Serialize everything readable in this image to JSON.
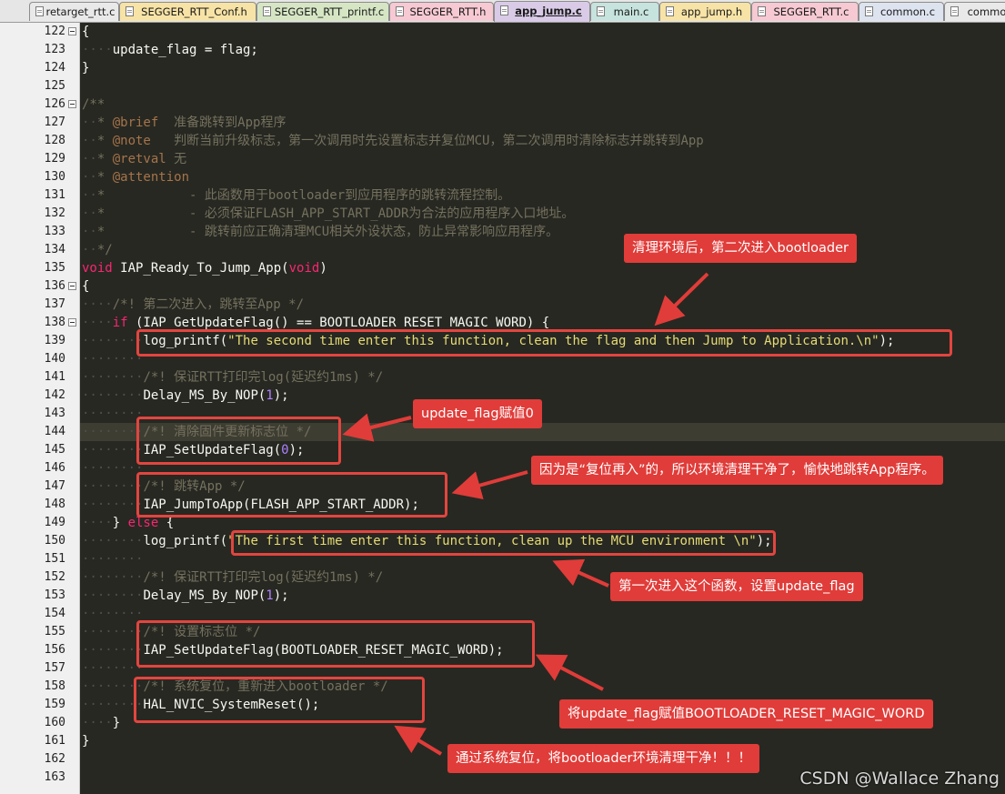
{
  "tabs": [
    {
      "label": "retarget_rtt.c",
      "color": "#e9e9e9",
      "active": false
    },
    {
      "label": "SEGGER_RTT_Conf.h",
      "color": "#f7e3a6",
      "active": false
    },
    {
      "label": "SEGGER_RTT_printf.c",
      "color": "#d6e6c4",
      "active": false
    },
    {
      "label": "SEGGER_RTT.h",
      "color": "#f6c9d3",
      "active": false
    },
    {
      "label": "app_jump.c",
      "color": "#d9cbe7",
      "active": true
    },
    {
      "label": "main.c",
      "color": "#c6e3dd",
      "active": false
    },
    {
      "label": "app_jump.h",
      "color": "#f7e3a6",
      "active": false
    },
    {
      "label": "SEGGER_RTT.c",
      "color": "#f6c9d3",
      "active": false
    },
    {
      "label": "common.c",
      "color": "#dde3ef",
      "active": false
    },
    {
      "label": "commo",
      "color": "#e9e9e9",
      "active": false
    }
  ],
  "highlighted_line": 144,
  "lines": [
    {
      "n": "122",
      "fold": true,
      "tokens": [
        [
          "p",
          "{"
        ]
      ]
    },
    {
      "n": "123",
      "fold": false,
      "tokens": [
        [
          "ws",
          "····"
        ],
        [
          "p",
          "update_flag = flag;"
        ]
      ]
    },
    {
      "n": "124",
      "fold": false,
      "tokens": [
        [
          "p",
          "}"
        ]
      ]
    },
    {
      "n": "125",
      "fold": false,
      "tokens": []
    },
    {
      "n": "126",
      "fold": true,
      "tokens": [
        [
          "cm",
          "/**"
        ]
      ]
    },
    {
      "n": "127",
      "fold": false,
      "tokens": [
        [
          "ws",
          "··"
        ],
        [
          "cm",
          "* "
        ],
        [
          "tag",
          "@brief"
        ],
        [
          "cm",
          "  准备跳转到App程序"
        ]
      ]
    },
    {
      "n": "128",
      "fold": false,
      "tokens": [
        [
          "ws",
          "··"
        ],
        [
          "cm",
          "* "
        ],
        [
          "tag",
          "@note"
        ],
        [
          "cm",
          "   判断当前升级标志，第一次调用时先设置标志并复位MCU，第二次调用时清除标志并跳转到App"
        ]
      ]
    },
    {
      "n": "129",
      "fold": false,
      "tokens": [
        [
          "ws",
          "··"
        ],
        [
          "cm",
          "* "
        ],
        [
          "tag",
          "@retval"
        ],
        [
          "cm",
          " 无"
        ]
      ]
    },
    {
      "n": "130",
      "fold": false,
      "tokens": [
        [
          "ws",
          "··"
        ],
        [
          "cm",
          "* "
        ],
        [
          "tag",
          "@attention"
        ]
      ]
    },
    {
      "n": "131",
      "fold": false,
      "tokens": [
        [
          "ws",
          "··"
        ],
        [
          "cm",
          "*           - 此函数用于bootloader到应用程序的跳转流程控制。"
        ]
      ]
    },
    {
      "n": "132",
      "fold": false,
      "tokens": [
        [
          "ws",
          "··"
        ],
        [
          "cm",
          "*           - 必须保证FLASH_APP_START_ADDR为合法的应用程序入口地址。"
        ]
      ]
    },
    {
      "n": "133",
      "fold": false,
      "tokens": [
        [
          "ws",
          "··"
        ],
        [
          "cm",
          "*           - 跳转前应正确清理MCU相关外设状态，防止异常影响应用程序。"
        ]
      ]
    },
    {
      "n": "134",
      "fold": false,
      "tokens": [
        [
          "ws",
          "··"
        ],
        [
          "cm",
          "*/"
        ]
      ]
    },
    {
      "n": "135",
      "fold": false,
      "tokens": [
        [
          "kw",
          "void"
        ],
        [
          "p",
          " IAP_Ready_To_Jump_App("
        ],
        [
          "kw",
          "void"
        ],
        [
          "p",
          ")"
        ]
      ]
    },
    {
      "n": "136",
      "fold": true,
      "tokens": [
        [
          "p",
          "{"
        ]
      ]
    },
    {
      "n": "137",
      "fold": false,
      "tokens": [
        [
          "ws",
          "····"
        ],
        [
          "cm",
          "/*! 第二次进入，跳转至App */"
        ]
      ]
    },
    {
      "n": "138",
      "fold": true,
      "tokens": [
        [
          "ws",
          "····"
        ],
        [
          "kw",
          "if"
        ],
        [
          "p",
          " (IAP_GetUpdateFlag() == BOOTLOADER_RESET_MAGIC_WORD) {"
        ]
      ]
    },
    {
      "n": "139",
      "fold": false,
      "tokens": [
        [
          "ws",
          "········"
        ],
        [
          "p",
          "log_printf("
        ],
        [
          "str",
          "\"The second time enter this function, clean the flag and then Jump to Application.\\n\""
        ],
        [
          "p",
          ");"
        ]
      ]
    },
    {
      "n": "140",
      "fold": false,
      "tokens": [
        [
          "ws",
          "········"
        ]
      ]
    },
    {
      "n": "141",
      "fold": false,
      "tokens": [
        [
          "ws",
          "········"
        ],
        [
          "cm",
          "/*! 保证RTT打印完log(延迟约1ms) */"
        ]
      ]
    },
    {
      "n": "142",
      "fold": false,
      "tokens": [
        [
          "ws",
          "········"
        ],
        [
          "p",
          "Delay_MS_By_NOP("
        ],
        [
          "num",
          "1"
        ],
        [
          "p",
          ");"
        ]
      ]
    },
    {
      "n": "143",
      "fold": false,
      "tokens": [
        [
          "ws",
          "········"
        ]
      ]
    },
    {
      "n": "144",
      "fold": false,
      "tokens": [
        [
          "ws",
          "········"
        ],
        [
          "cm",
          "/*! 清除固件更新标志位 */"
        ]
      ]
    },
    {
      "n": "145",
      "fold": false,
      "tokens": [
        [
          "ws",
          "········"
        ],
        [
          "p",
          "IAP_SetUpdateFlag("
        ],
        [
          "num",
          "0"
        ],
        [
          "p",
          ");"
        ]
      ]
    },
    {
      "n": "146",
      "fold": false,
      "tokens": [
        [
          "ws",
          "········"
        ]
      ]
    },
    {
      "n": "147",
      "fold": false,
      "tokens": [
        [
          "ws",
          "········"
        ],
        [
          "cm",
          "/*! 跳转App */"
        ]
      ]
    },
    {
      "n": "148",
      "fold": false,
      "tokens": [
        [
          "ws",
          "········"
        ],
        [
          "p",
          "IAP_JumpToApp(FLASH_APP_START_ADDR);"
        ]
      ]
    },
    {
      "n": "149",
      "fold": false,
      "tokens": [
        [
          "ws",
          "····"
        ],
        [
          "p",
          "} "
        ],
        [
          "kw",
          "else"
        ],
        [
          "p",
          " {"
        ]
      ]
    },
    {
      "n": "150",
      "fold": false,
      "tokens": [
        [
          "ws",
          "········"
        ],
        [
          "p",
          "log_printf("
        ],
        [
          "str",
          "\"The first time enter this function, clean up the MCU environment \\n\""
        ],
        [
          "p",
          ");"
        ]
      ]
    },
    {
      "n": "151",
      "fold": false,
      "tokens": [
        [
          "ws",
          "········"
        ]
      ]
    },
    {
      "n": "152",
      "fold": false,
      "tokens": [
        [
          "ws",
          "········"
        ],
        [
          "cm",
          "/*! 保证RTT打印完log(延迟约1ms) */"
        ]
      ]
    },
    {
      "n": "153",
      "fold": false,
      "tokens": [
        [
          "ws",
          "········"
        ],
        [
          "p",
          "Delay_MS_By_NOP("
        ],
        [
          "num",
          "1"
        ],
        [
          "p",
          ");"
        ]
      ]
    },
    {
      "n": "154",
      "fold": false,
      "tokens": [
        [
          "ws",
          "········"
        ]
      ]
    },
    {
      "n": "155",
      "fold": false,
      "tokens": [
        [
          "ws",
          "········"
        ],
        [
          "cm",
          "/*! 设置标志位 */"
        ]
      ]
    },
    {
      "n": "156",
      "fold": false,
      "tokens": [
        [
          "ws",
          "········"
        ],
        [
          "p",
          "IAP_SetUpdateFlag(BOOTLOADER_RESET_MAGIC_WORD);"
        ]
      ]
    },
    {
      "n": "157",
      "fold": false,
      "tokens": [
        [
          "ws",
          "········"
        ]
      ]
    },
    {
      "n": "158",
      "fold": false,
      "tokens": [
        [
          "ws",
          "········"
        ],
        [
          "cm",
          "/*! 系统复位，重新进入bootloader */"
        ]
      ]
    },
    {
      "n": "159",
      "fold": false,
      "tokens": [
        [
          "ws",
          "········"
        ],
        [
          "p",
          "HAL_NVIC_SystemReset();"
        ]
      ]
    },
    {
      "n": "160",
      "fold": false,
      "tokens": [
        [
          "ws",
          "····"
        ],
        [
          "p",
          "}"
        ]
      ]
    },
    {
      "n": "161",
      "fold": false,
      "tokens": [
        [
          "p",
          "}"
        ]
      ]
    },
    {
      "n": "162",
      "fold": false,
      "tokens": []
    },
    {
      "n": "163",
      "fold": false,
      "tokens": []
    }
  ],
  "annotations": [
    {
      "name": "annotation-second-entry",
      "text": "清理环境后，第二次进入bootloader"
    },
    {
      "name": "annotation-clear-flag",
      "text": "update_flag赋值0"
    },
    {
      "name": "annotation-jump-app",
      "text": "因为是“复位再入”的，所以环境清理干净了，愉快地跳转App程序。"
    },
    {
      "name": "annotation-first-entry",
      "text": "第一次进入这个函数，设置update_flag"
    },
    {
      "name": "annotation-set-magic",
      "text": "将update_flag赋值BOOTLOADER_RESET_MAGIC_WORD"
    },
    {
      "name": "annotation-system-reset",
      "text": "通过系统复位，将bootloader环境清理干净！！！"
    }
  ],
  "accent_color": "#e03c39",
  "watermark": "CSDN @Wallace Zhang"
}
